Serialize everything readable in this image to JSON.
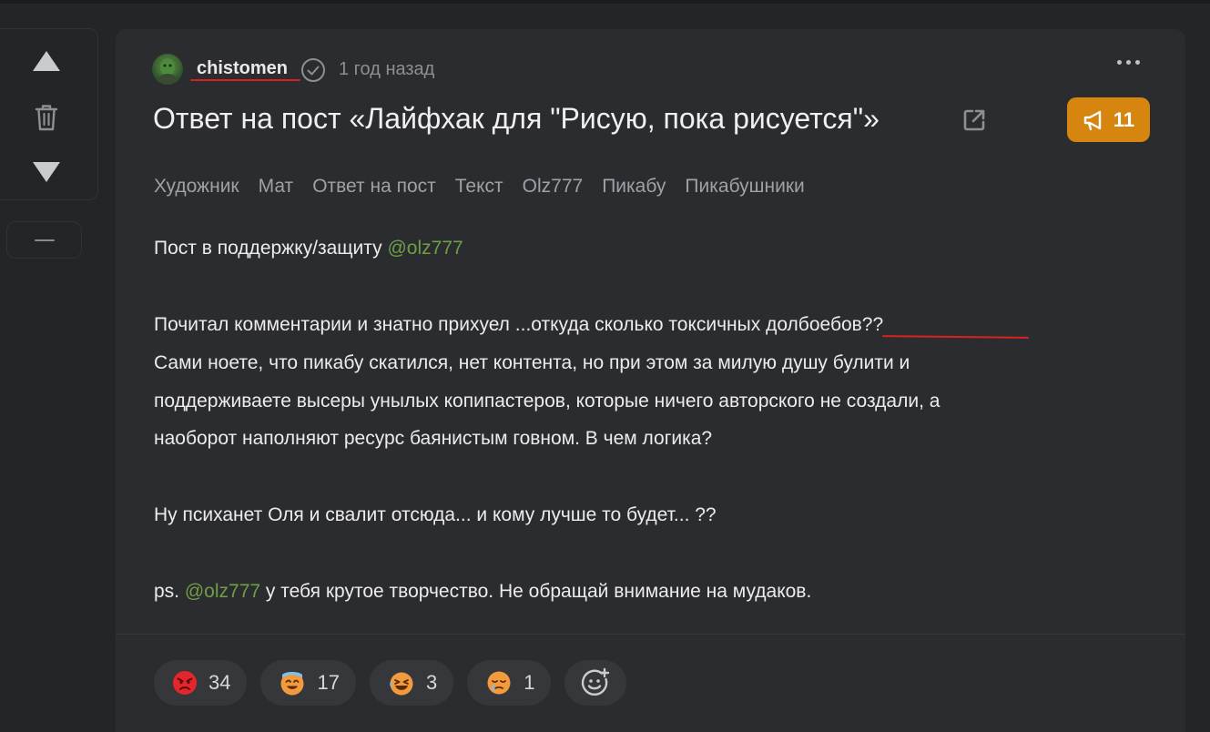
{
  "post": {
    "author": "chistomen",
    "time": "1 год назад",
    "title": "Ответ на пост «Лайфхак для \"Рисую, пока рисуется\"»",
    "comments_count": "11",
    "tags": [
      "Художник",
      "Мат",
      "Ответ на пост",
      "Текст",
      "Olz777",
      "Пикабу",
      "Пикабушники"
    ],
    "body": {
      "p1_text": "Пост в поддержку/защиту ",
      "p1_mention": "@olz777",
      "p2_l1_a": "Почитал комментарии и знатно прихуел ...откуда сколько токсичных ",
      "p2_l1_b": "долбоебов??",
      "p2_l2": "Сами ноете, что пикабу скатился, нет контента, но при этом за милую душу булити и",
      "p2_l3": "поддерживаете высеры унылых копипастеров, которые ничего авторского не создали, а",
      "p2_l4": "наоборот наполняют ресурс баянистым говном. В чем логика?",
      "p3": "Ну психанет Оля и свалит отсюда... и кому лучше то будет... ??",
      "p4_a": "ps. ",
      "p4_mention": "@olz777",
      "p4_b": " у тебя крутое творчество. Не обращай внимание на мудаков."
    }
  },
  "reactions": [
    {
      "icon": "angry-face-icon",
      "count": "34"
    },
    {
      "icon": "sweat-smile-face-icon",
      "count": "17"
    },
    {
      "icon": "laughing-face-icon",
      "count": "3"
    },
    {
      "icon": "crying-face-icon",
      "count": "1"
    }
  ],
  "colors": {
    "background": "#242528",
    "card": "#2b2c30",
    "accent": "#d6860f",
    "mention": "#6f9e45",
    "underline": "#d8221f"
  }
}
